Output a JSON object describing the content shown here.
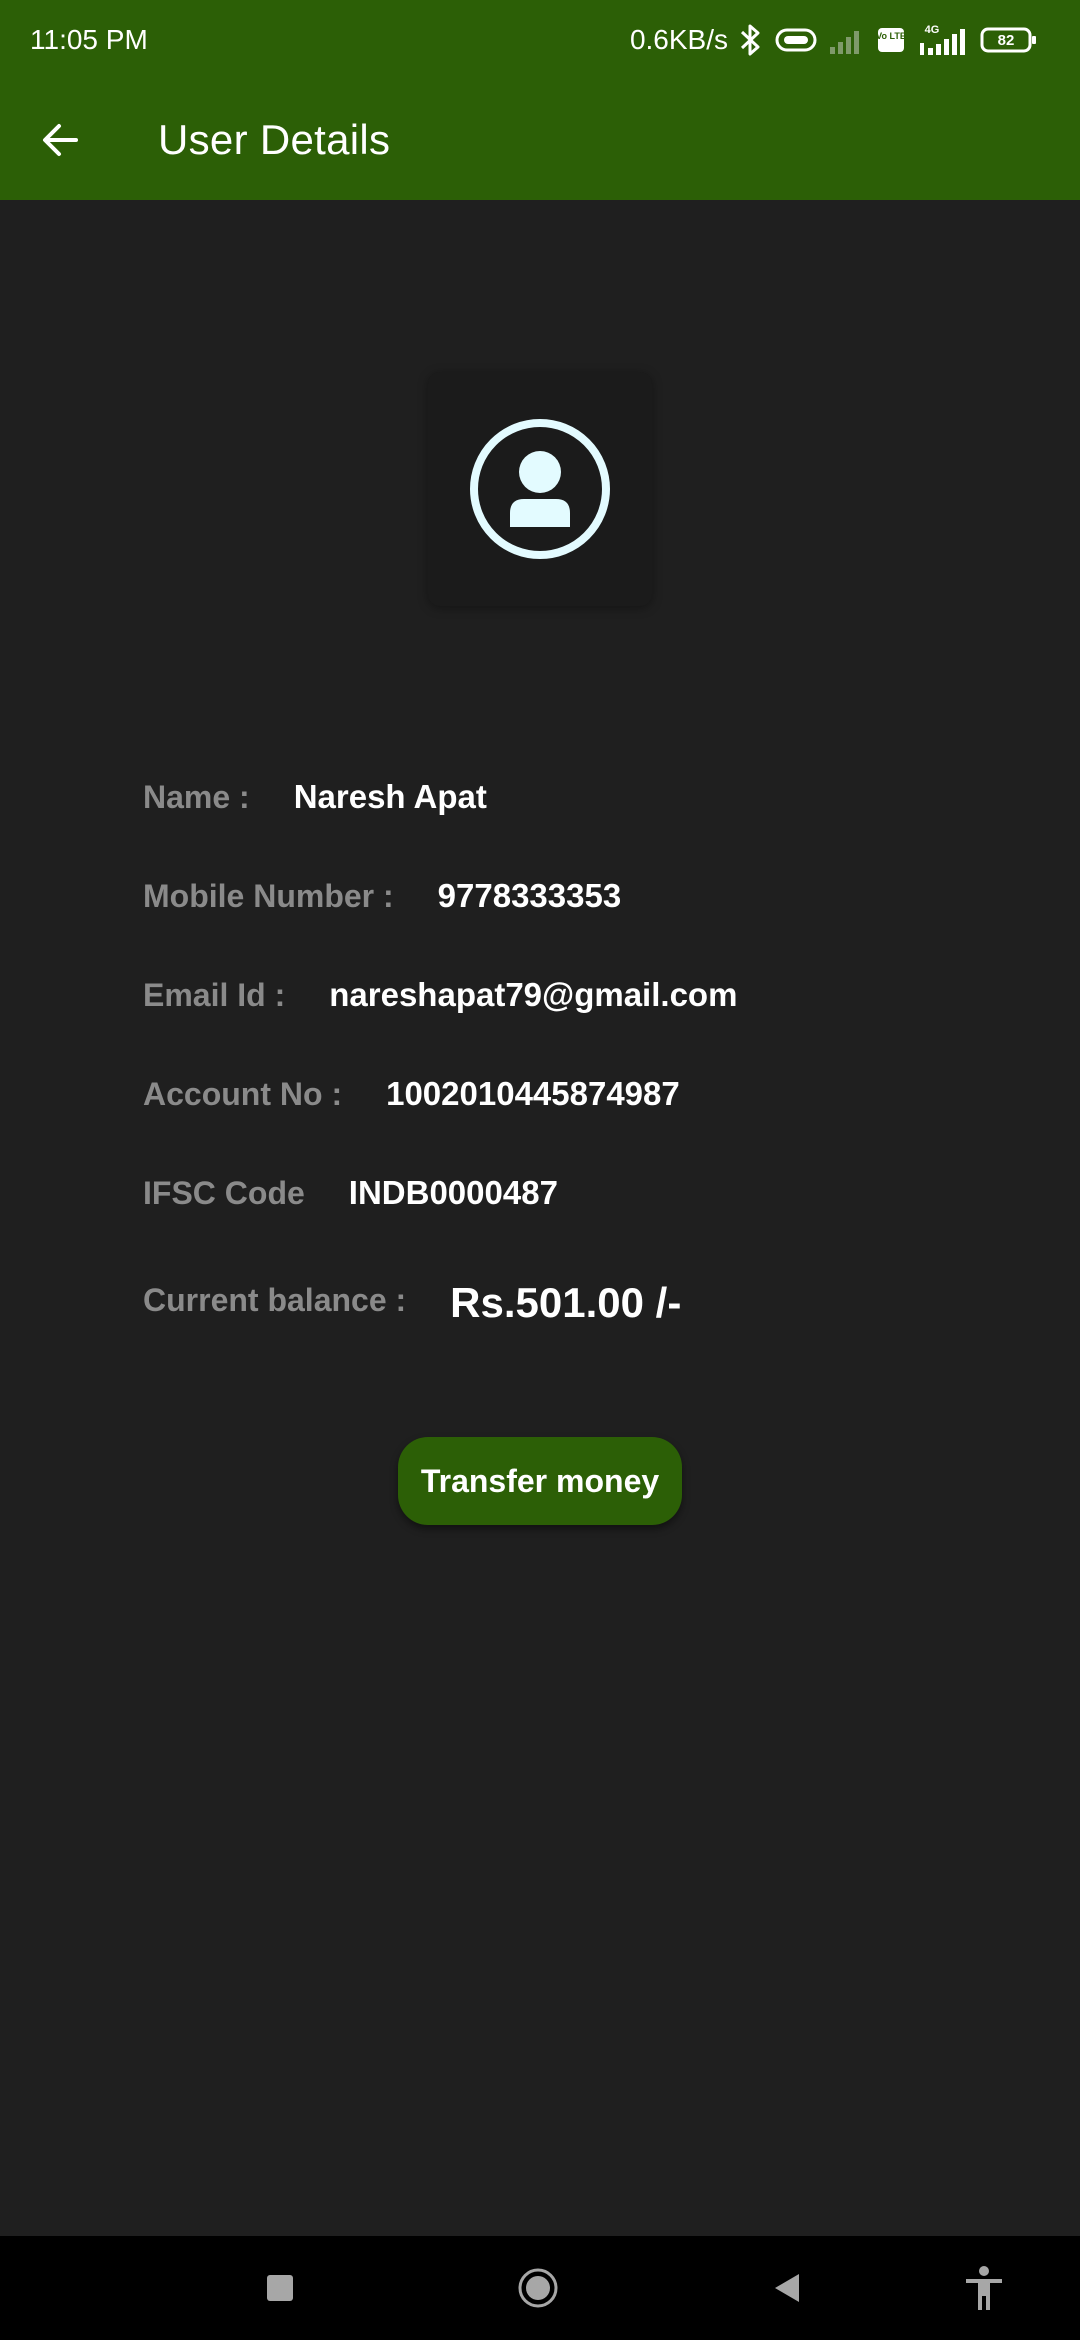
{
  "status_bar": {
    "time": "11:05 PM",
    "net_speed": "0.6KB/s",
    "battery_level": "82",
    "network_type": "4G",
    "volte_label": "Vo LTE",
    "icons": [
      "bluetooth-icon",
      "data-saver-icon",
      "signal-weak-icon",
      "volte-icon",
      "signal-4g-icon",
      "battery-icon"
    ]
  },
  "app_bar": {
    "title": "User Details",
    "back_icon": "arrow-left-icon"
  },
  "avatar": {
    "icon": "account-circle-icon"
  },
  "details": {
    "name_label": "Name :",
    "name_value": "Naresh Apat",
    "mobile_label": "Mobile Number :",
    "mobile_value": "9778333353",
    "email_label": "Email Id :",
    "email_value": "nareshapat79@gmail.com",
    "account_label": "Account No :",
    "account_value": "1002010445874987",
    "ifsc_label": "IFSC Code",
    "ifsc_value": "INDB0000487",
    "balance_label": "Current balance :",
    "balance_value": "Rs.501.00 /-"
  },
  "actions": {
    "transfer_label": "Transfer money"
  },
  "nav_bar": {
    "icons": [
      "recents-square-icon",
      "home-circle-icon",
      "back-triangle-icon",
      "accessibility-icon"
    ]
  },
  "colors": {
    "primary": "#2c5f06",
    "background": "#1f1f1f",
    "label": "#8a8a8a",
    "value": "#ffffff",
    "avatar_tint": "#e3fbff"
  }
}
